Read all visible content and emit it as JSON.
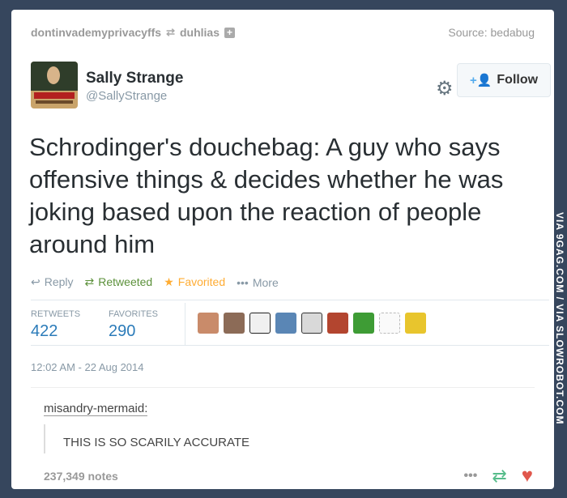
{
  "header": {
    "left_user": "dontinvademyprivacyffs",
    "reblog_glyph": "⇄",
    "reblogged_from": "duhlias",
    "plus_glyph": "+",
    "source": "Source: bedabug"
  },
  "tweet": {
    "name": "Sally Strange",
    "handle": "@SallyStrange",
    "follow_label": "Follow",
    "text": "Schrodinger's douchebag: A guy who says offensive things & decides whether he was joking based upon the reaction of people around him",
    "actions": {
      "reply": "Reply",
      "retweeted": "Retweeted",
      "favorited": "Favorited",
      "more": "More"
    },
    "stats": {
      "retweets_label": "RETWEETS",
      "retweets_value": "422",
      "favorites_label": "FAVORITES",
      "favorites_value": "290"
    },
    "timestamp": "12:02 AM - 22 Aug 2014"
  },
  "comment": {
    "user": "misandry-mermaid:",
    "text": "THIS IS SO SCARILY ACCURATE"
  },
  "footer": {
    "notes": "237,349 notes"
  },
  "watermark": "VIA 9GAG.COM / VIA SLOWROBOT.COM",
  "icons": {
    "gear": "gear-icon",
    "follow": "add-user-icon",
    "reply": "reply-icon",
    "retweet": "retweet-icon",
    "favorite": "star-icon",
    "heart": "heart-icon"
  },
  "colors": {
    "background": "#36465d",
    "link": "#2b7bb9",
    "retweet": "#5c913b",
    "favorite": "#ffac33",
    "heart": "#e0574c",
    "follow_icon": "#55acee"
  }
}
